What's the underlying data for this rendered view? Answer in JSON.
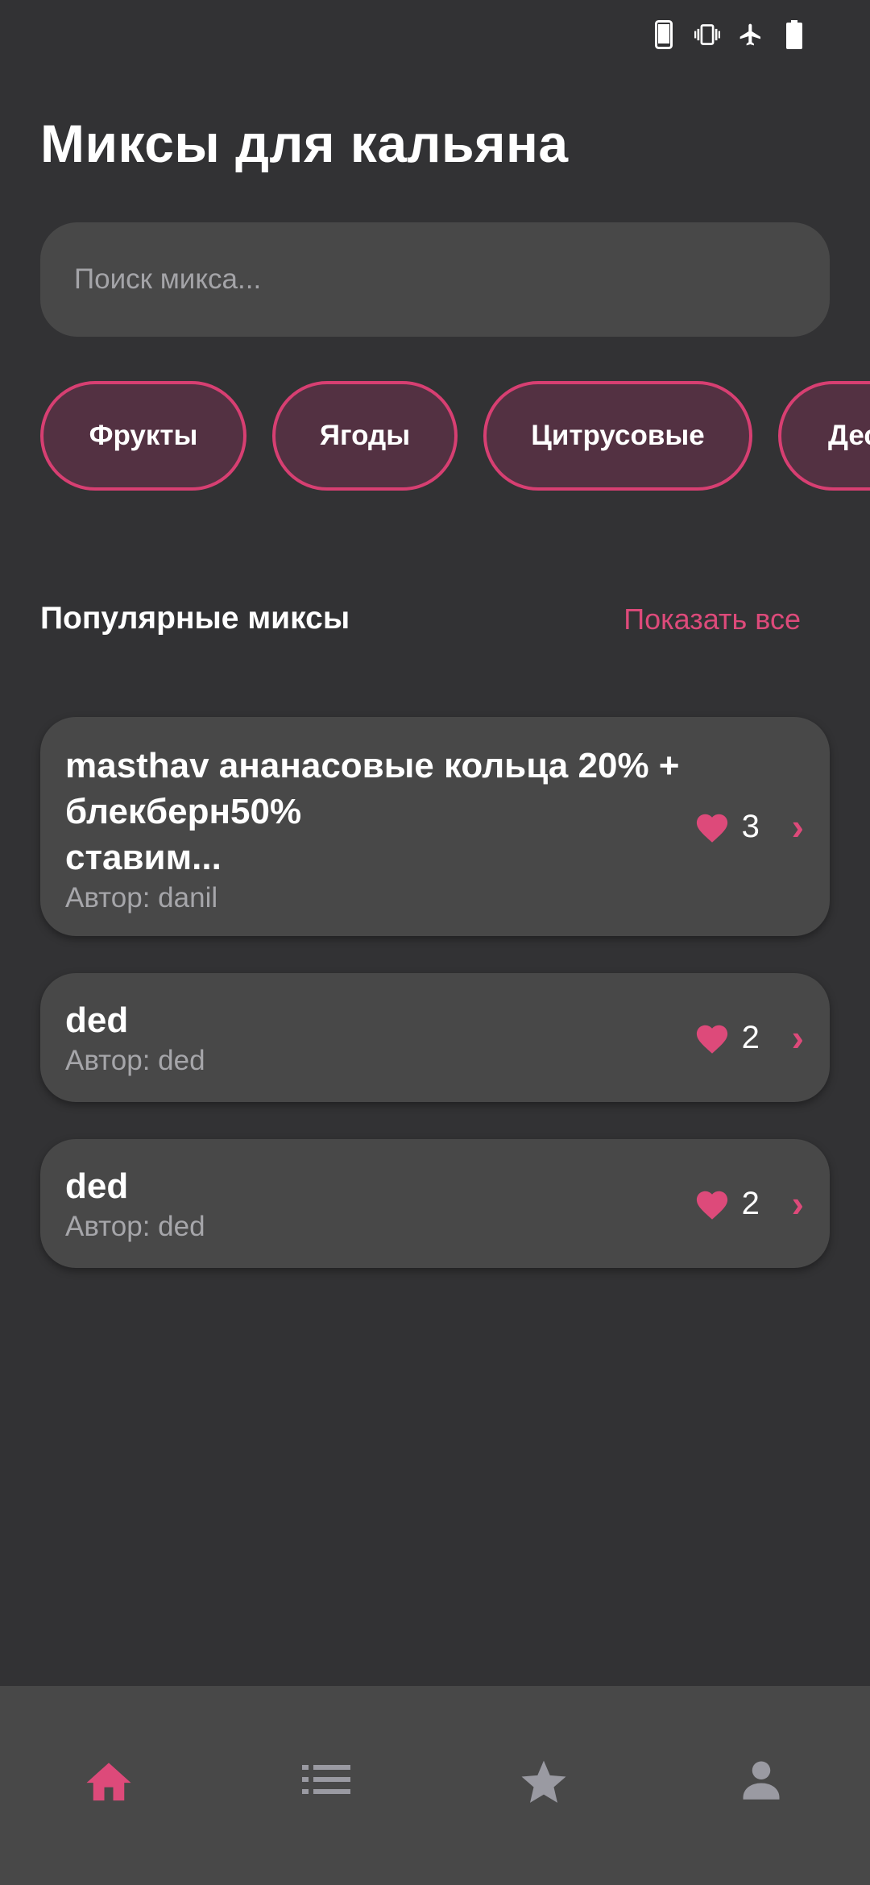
{
  "status_bar": {
    "icons": [
      "phone-icon",
      "vibrate-icon",
      "airplane-mode-icon",
      "battery-icon"
    ]
  },
  "header": {
    "title": "Миксы для кальяна"
  },
  "search": {
    "placeholder": "Поиск микса...",
    "value": ""
  },
  "categories": [
    {
      "label": "Фрукты"
    },
    {
      "label": "Ягоды"
    },
    {
      "label": "Цитрусовые"
    },
    {
      "label": "Десерты"
    }
  ],
  "popular": {
    "title": "Популярные миксы",
    "show_all_label": "Показать все"
  },
  "mixes": [
    {
      "title": "masthav ананасовые кольца 20% +\nблекберн50%\nставим...",
      "author": "Автор: danil",
      "likes": "3"
    },
    {
      "title": "ded",
      "author": "Автор: ded",
      "likes": "2"
    },
    {
      "title": "ded",
      "author": "Автор: ded",
      "likes": "2"
    }
  ],
  "bottom_nav": {
    "items": [
      {
        "icon": "home-icon",
        "active": true
      },
      {
        "icon": "list-icon",
        "active": false
      },
      {
        "icon": "star-icon",
        "active": false
      },
      {
        "icon": "profile-icon",
        "active": false
      }
    ]
  },
  "colors": {
    "background": "#323234",
    "surface": "#484848",
    "accent": "#dd4a7a",
    "chip_fill": "#533142",
    "inactive_icon": "#9a9aa2"
  }
}
